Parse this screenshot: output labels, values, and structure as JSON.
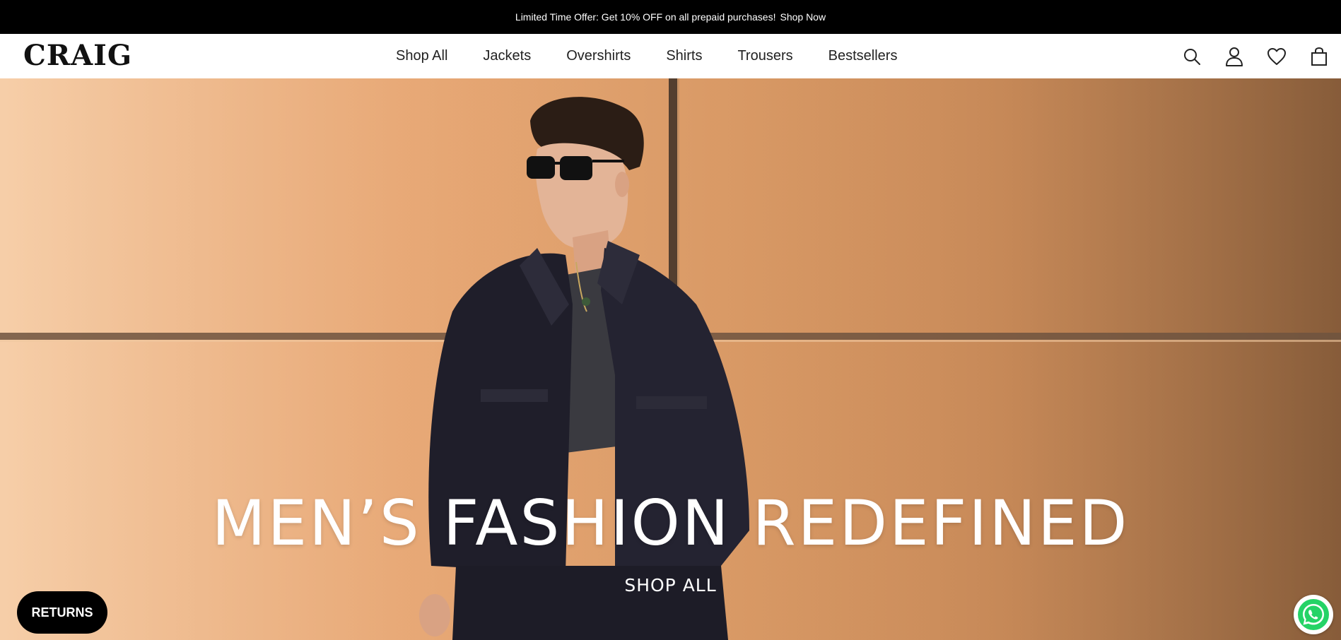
{
  "announcement": {
    "offer_text": "Limited Time Offer: Get 10% OFF on all prepaid purchases!",
    "link_text": "Shop Now"
  },
  "header": {
    "logo": "CRAIG",
    "nav": [
      "Shop All",
      "Jackets",
      "Overshirts",
      "Shirts",
      "Trousers",
      "Bestsellers"
    ],
    "icons": [
      "search-icon",
      "account-icon",
      "wishlist-heart-icon",
      "cart-bag-icon"
    ]
  },
  "hero": {
    "title": "MEN’S FASHION REDEFINED",
    "cta": "SHOP ALL"
  },
  "floating": {
    "returns_label": "RETURNS",
    "whatsapp_icon": "whatsapp-icon"
  },
  "colors": {
    "announcement_bg": "#000000",
    "returns_bg": "#000000",
    "whatsapp": "#25d366",
    "hero_wall": "#e0a06c"
  }
}
